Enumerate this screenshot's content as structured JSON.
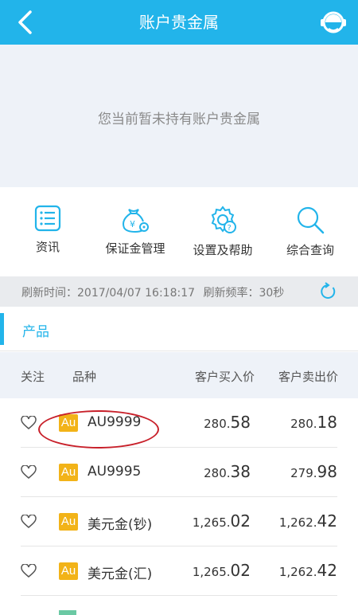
{
  "header": {
    "title": "账户贵金属"
  },
  "empty": {
    "message": "您当前暂未持有账户贵金属"
  },
  "shortcuts": [
    {
      "label": "资讯",
      "icon": "news-list-icon"
    },
    {
      "label": "保证金管理",
      "icon": "money-bag-gear-icon"
    },
    {
      "label": "设置及帮助",
      "icon": "gear-question-icon"
    },
    {
      "label": "综合查询",
      "icon": "search-icon"
    }
  ],
  "refresh": {
    "time": "刷新时间：2017/04/07  16:18:17",
    "rate": "刷新频率：30秒"
  },
  "section": {
    "title": "产品"
  },
  "columns": {
    "follow": "关注",
    "variety": "品种",
    "buy": "客户买入价",
    "sell": "客户卖出价"
  },
  "badge": {
    "text": "Au"
  },
  "products": [
    {
      "name": "AU9999",
      "buy_int": "280.",
      "buy_dec": "58",
      "sell_int": "280.",
      "sell_dec": "18"
    },
    {
      "name": "AU9995",
      "buy_int": "280.",
      "buy_dec": "38",
      "sell_int": "279.",
      "sell_dec": "98"
    },
    {
      "name": "美元金(钞)",
      "buy_int": "1,265.",
      "buy_dec": "02",
      "sell_int": "1,262.",
      "sell_dec": "42"
    },
    {
      "name": "美元金(汇)",
      "buy_int": "1,265.",
      "buy_dec": "02",
      "sell_int": "1,262.",
      "sell_dec": "42"
    }
  ],
  "colors": {
    "accent": "#22b4ea",
    "badge": "#f2b318",
    "highlight": "#c8202a"
  }
}
